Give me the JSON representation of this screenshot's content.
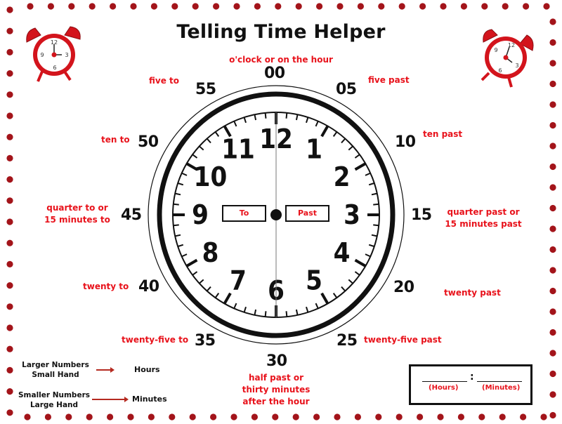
{
  "title": "Telling Time Helper",
  "colors": {
    "accent_red": "#e8121b",
    "dot_red": "#a3141a",
    "alarm_red": "#d3141c",
    "ink": "#111111"
  },
  "icons": {
    "left_alarm": "alarm-clock-icon",
    "right_alarm": "alarm-clock-icon"
  },
  "minute_labels": [
    {
      "minute": "00",
      "phrase": "o'clock or on the hour"
    },
    {
      "minute": "05",
      "phrase": "five past"
    },
    {
      "minute": "10",
      "phrase": "ten past"
    },
    {
      "minute": "15",
      "phrase": "quarter past or\n15 minutes past"
    },
    {
      "minute": "20",
      "phrase": "twenty past"
    },
    {
      "minute": "25",
      "phrase": "twenty-five past"
    },
    {
      "minute": "30",
      "phrase": "half past or\nthirty minutes\nafter the hour"
    },
    {
      "minute": "35",
      "phrase": "twenty-five to"
    },
    {
      "minute": "40",
      "phrase": "twenty to"
    },
    {
      "minute": "45",
      "phrase": "quarter to or\n15 minutes to"
    },
    {
      "minute": "50",
      "phrase": "ten to"
    },
    {
      "minute": "55",
      "phrase": "five to"
    }
  ],
  "clock": {
    "hour_numbers": [
      "12",
      "1",
      "2",
      "3",
      "4",
      "5",
      "6",
      "7",
      "8",
      "9",
      "10",
      "11"
    ],
    "to_label": "To",
    "past_label": "Past"
  },
  "legend": [
    {
      "line1": "Larger Numbers",
      "line2": "Small Hand",
      "target": "Hours"
    },
    {
      "line1": "Smaller Numbers",
      "line2": "Large Hand",
      "target": "Minutes"
    }
  ],
  "answer_box": {
    "separator": ":",
    "hours_label": "(Hours)",
    "minutes_label": "(Minutes)"
  },
  "alarm_clocks": [
    {
      "numbers": [
        "12",
        "3",
        "6",
        "9"
      ],
      "time_shown": "3:00"
    },
    {
      "numbers": [
        "12",
        "3",
        "6",
        "9"
      ],
      "time_shown": "4:00"
    }
  ]
}
